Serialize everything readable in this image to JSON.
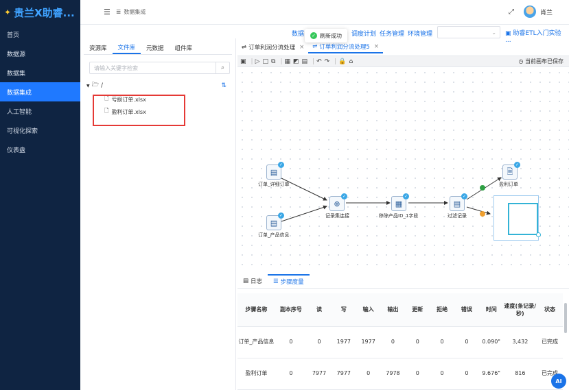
{
  "brand": {
    "logo_icon": "sparkle-logo-icon",
    "title": "贵兰X助睿..."
  },
  "sidebar": {
    "items": [
      {
        "label": "首页"
      },
      {
        "label": "数据源"
      },
      {
        "label": "数据集"
      },
      {
        "label": "数据集成",
        "active": true
      },
      {
        "label": "人工智能"
      },
      {
        "label": "可视化探索"
      },
      {
        "label": "仪表盘"
      }
    ]
  },
  "header": {
    "breadcrumb": "数据集成",
    "user_name": "肖兰",
    "menu_icon": "menu-toggle-icon",
    "expand_icon": "fullscreen-icon"
  },
  "subnav": {
    "items": [
      "数据",
      "调度计划",
      "任务管理",
      "环境管理"
    ],
    "select_value": "",
    "help_link": "助睿ETL入门实验 ..."
  },
  "toast": {
    "message": "刷新成功",
    "icon": "check-circle-icon"
  },
  "left_panel": {
    "tabs": [
      "资源库",
      "文件库",
      "元数据",
      "组件库"
    ],
    "active_tab": "文件库",
    "search_placeholder": "请输入关键字检索",
    "root": "/",
    "files": [
      "亏损订单.xlsx",
      "盈利订单.xlsx"
    ]
  },
  "editor": {
    "tabs": [
      {
        "label": "订单利润分流处理",
        "active": false
      },
      {
        "label": "订单利润分流处理5",
        "active": true
      }
    ],
    "save_status": "当前画布已保存"
  },
  "flow": {
    "nodes": [
      {
        "id": "n1",
        "label": "订单_详细订单"
      },
      {
        "id": "n2",
        "label": "订单_产品信息"
      },
      {
        "id": "n3",
        "label": "记录集连接"
      },
      {
        "id": "n4",
        "label": "移除产品ID_1字段"
      },
      {
        "id": "n5",
        "label": "过滤记录"
      },
      {
        "id": "n6",
        "label": "盈利订单"
      }
    ]
  },
  "bottom_panel": {
    "tabs": [
      {
        "label": "日志",
        "active": false
      },
      {
        "label": "步骤度量",
        "active": true
      }
    ],
    "columns": [
      "步骤名称",
      "副本序号",
      "读",
      "写",
      "输入",
      "输出",
      "更新",
      "拒绝",
      "错误",
      "时间",
      "速度(条记录/秒)",
      "状态"
    ],
    "rows": [
      [
        "订单_产品信息",
        "0",
        "0",
        "1977",
        "1977",
        "0",
        "0",
        "0",
        "0",
        "0.090\"",
        "3,432",
        "已完成"
      ],
      [
        "盈利订单",
        "0",
        "7977",
        "7977",
        "0",
        "7978",
        "0",
        "0",
        "0",
        "9.676\"",
        "816",
        "已完成"
      ]
    ]
  },
  "ai_button": "AI",
  "colors": {
    "sidebar_bg": "#0f2442",
    "accent": "#1a73e8",
    "highlight": "#e53935"
  }
}
